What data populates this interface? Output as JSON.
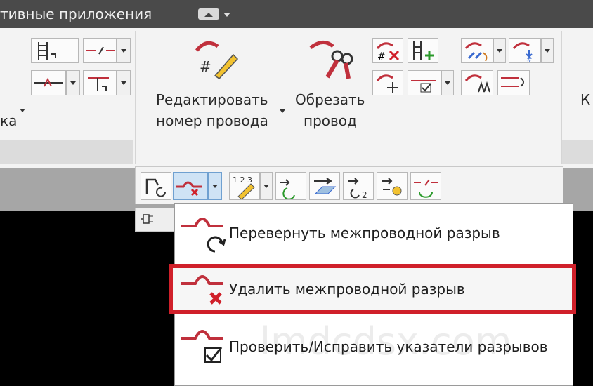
{
  "titlebar": {
    "title": "тивные приложения"
  },
  "ribbon": {
    "left_label": "ка",
    "edit_button": {
      "line1": "Редактировать",
      "line2": "номер провода"
    },
    "cut_button": {
      "line1": "Обрезать",
      "line2": "провод"
    },
    "right_clip": "К"
  },
  "menu": {
    "items": [
      {
        "label": "Перевернуть межпроводной разрыв",
        "icon": "flip-gap-icon"
      },
      {
        "label": "Удалить межпроводной разрыв",
        "icon": "delete-gap-icon",
        "highlighted": true
      },
      {
        "label": "Проверить/Исправить указатели разрывов",
        "icon": "check-gap-icon"
      }
    ]
  },
  "watermark": "lmdcdsx.com",
  "colors": {
    "wire": "#c0303c",
    "accent": "#d0202a",
    "pen": "#f2c230"
  }
}
